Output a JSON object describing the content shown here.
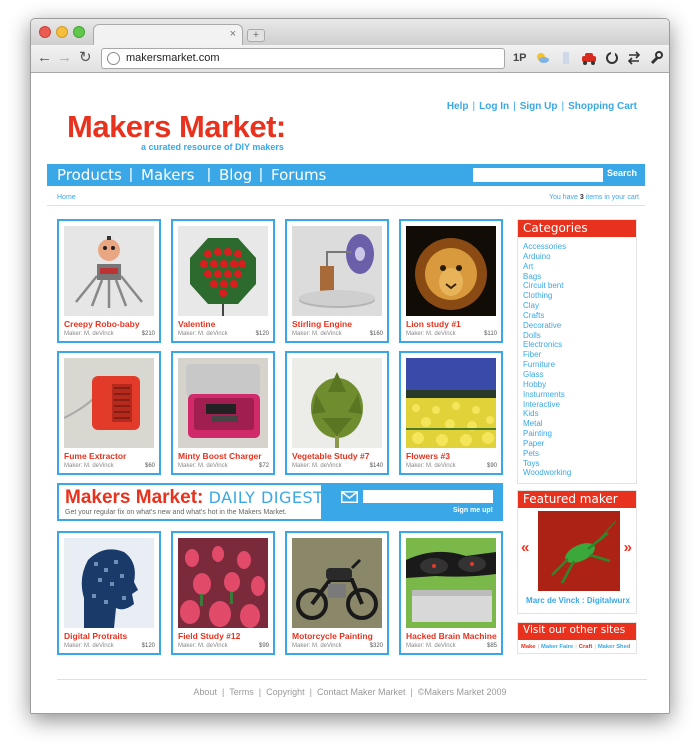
{
  "browser": {
    "url": "makersmarket.com",
    "tab_close": "×",
    "new_tab": "+",
    "back": "←",
    "forward": "→",
    "reload": "↻",
    "ext_1p": "1P"
  },
  "site": {
    "logo": "Makers Market:",
    "tagline": "a curated resource of DIY makers",
    "top_links": [
      "Help",
      "Log In",
      "Sign Up",
      "Shopping Cart"
    ],
    "link_sep": "|",
    "nav": [
      "Products",
      "Makers",
      "Blog",
      "Forums"
    ],
    "search_label": "Search",
    "breadcrumb": "Home",
    "cart_prefix": "You have",
    "cart_count": "3",
    "cart_suffix": "items in your cart"
  },
  "products": [
    {
      "name": "Creepy Robo-baby",
      "maker": "Maker: M. deVinck",
      "price": "$210"
    },
    {
      "name": "Valentine",
      "maker": "Maker: M. deVinck",
      "price": "$120"
    },
    {
      "name": "Stirling Engine",
      "maker": "Maker: M. deVinck",
      "price": "$160"
    },
    {
      "name": "Lion study #1",
      "maker": "Maker: M. deVinck",
      "price": "$110"
    },
    {
      "name": "Fume Extractor",
      "maker": "Maker: M. deVinck",
      "price": "$60"
    },
    {
      "name": "Minty Boost Charger",
      "maker": "Maker: M. deVinck",
      "price": "$72"
    },
    {
      "name": "Vegetable Study #7",
      "maker": "Maker: M. deVinck",
      "price": "$140"
    },
    {
      "name": "Flowers #3",
      "maker": "Maker: M. deVinck",
      "price": "$90"
    },
    {
      "name": "Digital Protraits",
      "maker": "Maker: M. deVinck",
      "price": "$120"
    },
    {
      "name": "Field Study #12",
      "maker": "Maker: M. deVinck",
      "price": "$99"
    },
    {
      "name": "Motorcycle Painting",
      "maker": "Maker: M. deVinck",
      "price": "$320"
    },
    {
      "name": "Hacked Brain Machine",
      "maker": "Maker: M. deVinck",
      "price": "$85"
    }
  ],
  "digest": {
    "title": "Makers Market:",
    "title_accent": "DAILY DIGEST",
    "subtitle": "Get your regular fix on what's new and what's hot in the Makers Market.",
    "signup": "Sign me up!"
  },
  "categories": {
    "title": "Categories",
    "items": [
      "Accessories",
      "Arduino",
      "Art",
      "Bags",
      "Circuit bent",
      "Clothing",
      "Clay",
      "Crafts",
      "Decorative",
      "Dolls",
      "Electronics",
      "Fiber",
      "Furniture",
      "Glass",
      "Hobby",
      "Insturments",
      "Interactive",
      "Kids",
      "Metal",
      "Painting",
      "Paper",
      "Pets",
      "Toys",
      "Woodworking"
    ]
  },
  "featured": {
    "title": "Featured maker",
    "name": "Marc de Vinck : Digitalwurx",
    "prev": "«",
    "next": "»"
  },
  "other_sites": {
    "title": "Visit our other sites",
    "sites": [
      "Make",
      "Maker Faire",
      "Craft",
      "Maker Shed"
    ]
  },
  "footer": {
    "links": [
      "About",
      "Terms",
      "Copyright",
      "Contact Maker Market"
    ],
    "copyright": "©Makers Market 2009"
  },
  "colors": {
    "brand_red": "#e8321e",
    "brand_blue": "#3aa8e6"
  }
}
